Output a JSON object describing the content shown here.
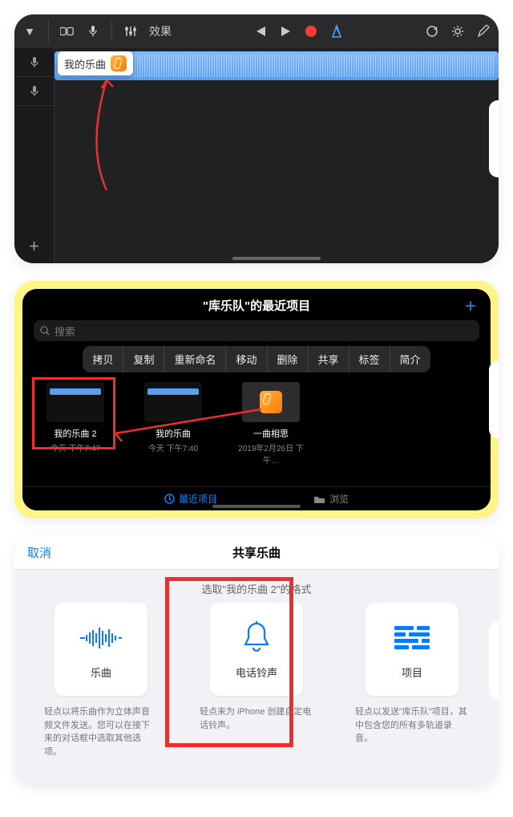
{
  "panel1": {
    "popup_label": "我的乐曲",
    "fx_label": "效果"
  },
  "panel2": {
    "title": "\"库乐队\"的最近项目",
    "search_placeholder": "搜索",
    "context_menu": [
      "拷贝",
      "复制",
      "重新命名",
      "移动",
      "删除",
      "共享",
      "标签",
      "简介"
    ],
    "files": [
      {
        "title": "我的乐曲 2",
        "subtitle": "今天 下午7:47",
        "kind": "wave"
      },
      {
        "title": "我的乐曲",
        "subtitle": "今天 下午7:40",
        "kind": "wave"
      },
      {
        "title": "一曲相思",
        "subtitle": "2019年2月26日 下午…",
        "kind": "gb"
      }
    ],
    "tabs": {
      "recent": "最近项目",
      "browse": "浏览"
    }
  },
  "panel3": {
    "cancel": "取消",
    "title": "共享乐曲",
    "subtitle": "选取\"我的乐曲 2\"的格式",
    "options": [
      {
        "label": "乐曲",
        "desc": "轻点以将乐曲作为立体声音频文件发送。您可以在接下来的对话框中选取其他选项。"
      },
      {
        "label": "电话铃声",
        "desc": "轻点来为 iPhone 创建自定电话铃声。"
      },
      {
        "label": "项目",
        "desc": "轻点以发送\"库乐队\"项目，其中包含您的所有多轨道录音。"
      }
    ]
  }
}
